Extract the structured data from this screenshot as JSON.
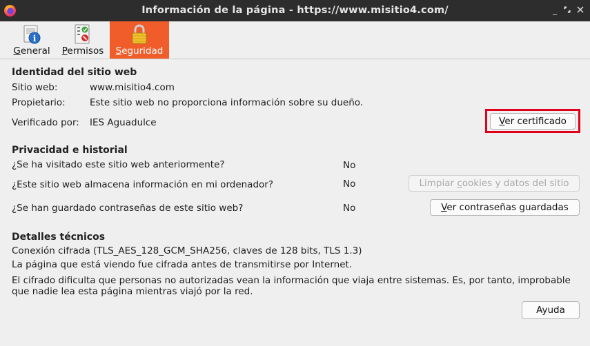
{
  "window": {
    "title": "Información de la página - https://www.misitio4.com/"
  },
  "tabs": [
    {
      "label": "General",
      "mnemonic": "G",
      "rest": "eneral",
      "icon": "info-icon"
    },
    {
      "label": "Permisos",
      "mnemonic": "P",
      "rest": "ermisos",
      "icon": "permissions-icon"
    },
    {
      "label": "Seguridad",
      "mnemonic": "S",
      "rest": "eguridad",
      "icon": "padlock-icon",
      "active": true
    }
  ],
  "identity": {
    "heading": "Identidad del sitio web",
    "website_label": "Sitio web:",
    "website_value": "www.misitio4.com",
    "owner_label": "Propietario:",
    "owner_value": "Este sitio web no proporciona información sobre su dueño.",
    "verified_label": "Verificado por:",
    "verified_value": "IES Aguadulce",
    "view_cert_mnemonic": "V",
    "view_cert_rest": "er certificado"
  },
  "privacy": {
    "heading": "Privacidad e historial",
    "q1": "¿Se ha visitado este sitio web anteriormente?",
    "a1": "No",
    "q2": "¿Este sitio web almacena información en mi ordenador?",
    "a2": "No",
    "clear_cookies_pre": "Limpiar ",
    "clear_cookies_mnemonic": "c",
    "clear_cookies_post": "ookies y datos del sitio",
    "q3": "¿Se han guardado contraseñas de este sitio web?",
    "a3": "No",
    "view_passwords_mnemonic": "V",
    "view_passwords_rest": "er contraseñas guardadas"
  },
  "technical": {
    "heading": "Detalles técnicos",
    "line1": "Conexión cifrada (TLS_AES_128_GCM_SHA256, claves de 128 bits, TLS 1.3)",
    "line2": "La página que está viendo fue cifrada antes de transmitirse por Internet.",
    "line3": "El cifrado dificulta que personas no autorizadas vean la información que viaja entre sistemas. Es, por tanto, improbable",
    "line4": "que nadie lea esta página mientras viajó por la red."
  },
  "footer": {
    "help_label": "Ayuda"
  },
  "colors": {
    "active_tab": "#f05c2a",
    "highlight": "#e1001a",
    "titlebar": "#2d2d2d"
  }
}
